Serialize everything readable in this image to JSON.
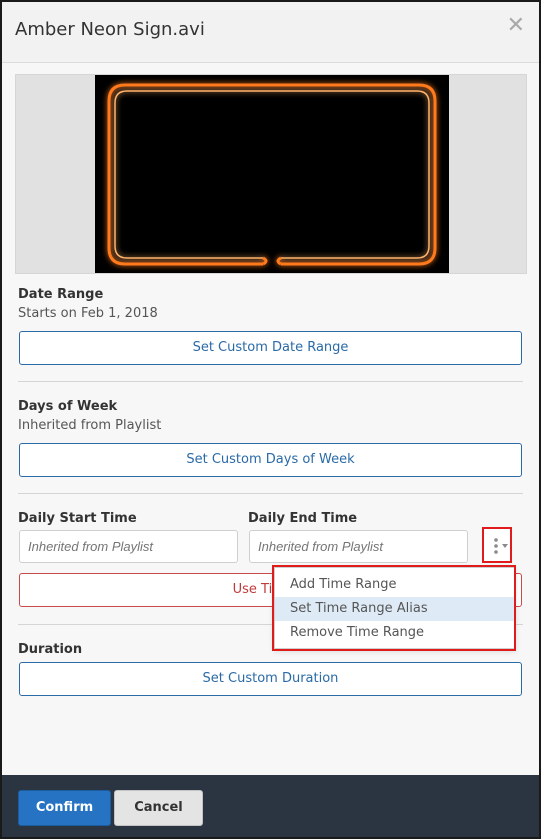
{
  "dialog": {
    "title": "Amber Neon Sign.avi",
    "close_icon": "close-icon",
    "close_glyph": "✕"
  },
  "date_range": {
    "label": "Date Range",
    "value": "Starts on Feb 1, 2018",
    "button": "Set Custom Date Range"
  },
  "days_of_week": {
    "label": "Days of Week",
    "value": "Inherited from Playlist",
    "button": "Set Custom Days of Week"
  },
  "times": {
    "start_label": "Daily Start Time",
    "start_value": "Inherited from Playlist",
    "end_label": "Daily End Time",
    "end_value": "Inherited from Playlist",
    "use_times_button": "Use Times f",
    "more_icon": "more-vertical-icon"
  },
  "menu": {
    "items": [
      "Add Time Range",
      "Set Time Range Alias",
      "Remove Time Range"
    ],
    "active_index": 1
  },
  "duration": {
    "label": "Duration",
    "button": "Set Custom Duration"
  },
  "footer": {
    "confirm": "Confirm",
    "cancel": "Cancel"
  },
  "colors": {
    "accent": "#2a6aa6",
    "primary": "#2573c2",
    "danger": "#c23b3b",
    "highlight": "#e01b1b",
    "neon": "#ff7a1a"
  }
}
